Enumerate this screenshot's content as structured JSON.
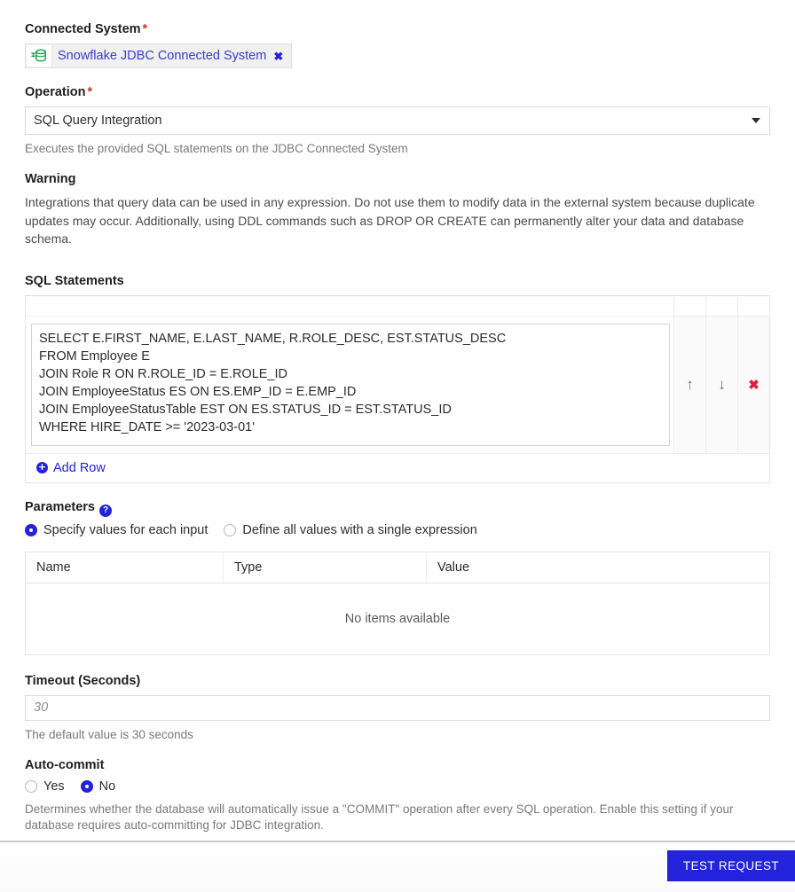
{
  "connected_system": {
    "label": "Connected System",
    "required": true,
    "chip": {
      "icon": "database-plug-icon",
      "text": "Snowflake JDBC Connected System",
      "remove": "✖"
    }
  },
  "operation": {
    "label": "Operation",
    "required": true,
    "selected": "SQL Query Integration",
    "options": [
      "SQL Query Integration"
    ],
    "hint": "Executes the provided SQL statements on the JDBC Connected System"
  },
  "warning": {
    "heading": "Warning",
    "body": "Integrations that query data can be used in any expression. Do not use them to modify data in the external system because duplicate updates may occur. Additionally, using DDL commands such as DROP OR CREATE can permanently alter your data and database schema."
  },
  "sql_statements": {
    "label": "SQL Statements",
    "rows": [
      {
        "sql": "SELECT E.FIRST_NAME, E.LAST_NAME, R.ROLE_DESC, EST.STATUS_DESC\nFROM Employee E\nJOIN Role R ON R.ROLE_ID = E.ROLE_ID\nJOIN EmployeeStatus ES ON ES.EMP_ID = E.EMP_ID\nJOIN EmployeeStatusTable EST ON ES.STATUS_ID = EST.STATUS_ID\nWHERE HIRE_DATE >= '2023-03-01'",
        "move_up": "↑",
        "move_down": "↓",
        "delete": "✖"
      }
    ],
    "add_row_label": "Add Row"
  },
  "parameters": {
    "label": "Parameters",
    "help_icon": "?",
    "modes": [
      {
        "label": "Specify values for each input",
        "selected": true
      },
      {
        "label": "Define all values with a single expression",
        "selected": false
      }
    ],
    "table": {
      "columns": [
        "Name",
        "Type",
        "Value"
      ],
      "rows": [],
      "empty_text": "No items available"
    }
  },
  "timeout": {
    "label": "Timeout (Seconds)",
    "value": "",
    "placeholder": "30",
    "hint": "The default value is 30 seconds"
  },
  "auto_commit": {
    "label": "Auto-commit",
    "options": [
      {
        "label": "Yes",
        "selected": false
      },
      {
        "label": "No",
        "selected": true
      }
    ],
    "hint": "Determines whether the database will automatically issue a \"COMMIT\" operation after every SQL operation. Enable this setting if your database requires auto-committing for JDBC integration."
  },
  "footer": {
    "test_button": "TEST REQUEST"
  },
  "colors": {
    "accent": "#2322dd",
    "link": "#3b3bd6",
    "required": "#c0392b",
    "delete": "#e02040",
    "icon_green": "#15a34a"
  }
}
